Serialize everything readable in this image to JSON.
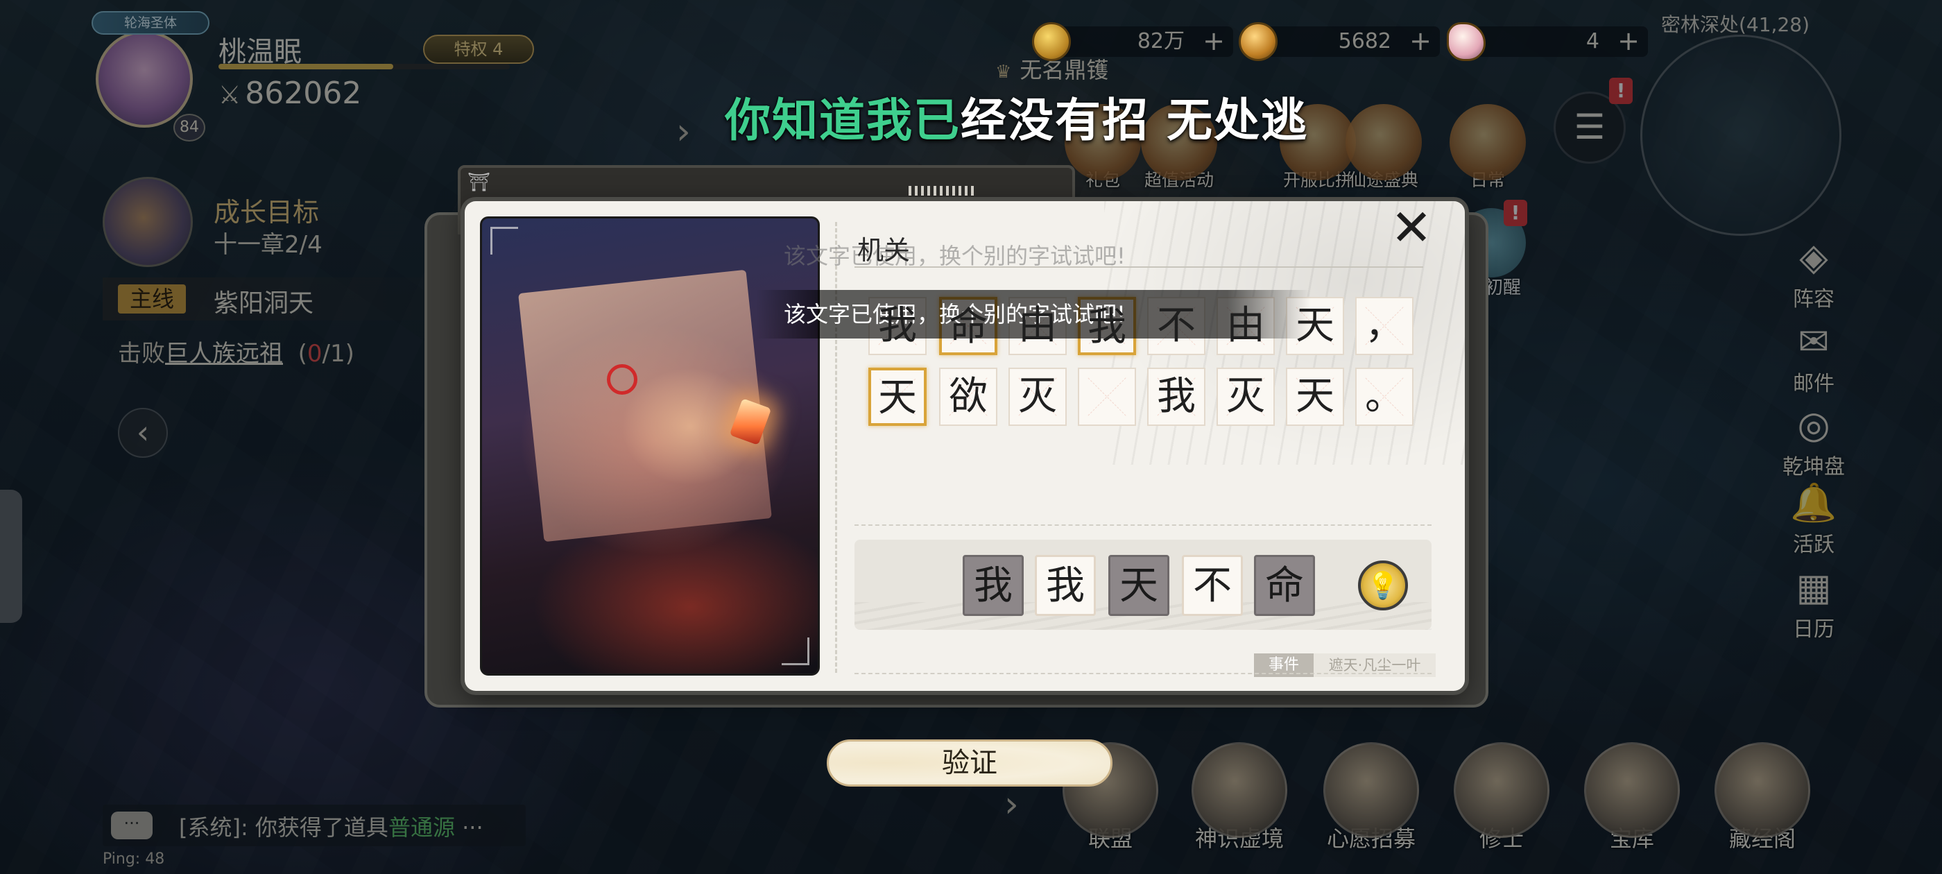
{
  "player": {
    "realm": "轮海圣体",
    "name": "桃温眠",
    "vip": "特权 4",
    "power": "862062",
    "level": "84"
  },
  "resources": [
    {
      "icon": "copper-coin-icon",
      "value": "82万"
    },
    {
      "icon": "gold-ingot-icon",
      "value": "5682"
    },
    {
      "icon": "feather-icon",
      "value": "4"
    }
  ],
  "plus_label": "+",
  "location": "密林深处(41,28)",
  "nameless": "无名鼎镬",
  "lyric": {
    "sung": "你知道我已",
    "rest": "经没有招 无处逃"
  },
  "top_activities": [
    {
      "label": "礼包"
    },
    {
      "label": "超值活动"
    },
    {
      "label": "开服比拼"
    },
    {
      "label": "仙途盛典"
    },
    {
      "label": "日常"
    }
  ],
  "menu_icon": "☰",
  "badge": "!",
  "goal": {
    "title": "成长目标",
    "progress": "十一章2/4"
  },
  "quest": {
    "tag": "主线",
    "name": "紫阳洞天",
    "desc_prefix": "击败",
    "target": "巨人族远祖",
    "count_open": "(",
    "count_done": "0",
    "count_total": "/1)"
  },
  "right_side": [
    {
      "icon": "formation-icon",
      "glyph": "◈",
      "label": "阵容"
    },
    {
      "icon": "mail-icon",
      "glyph": "✉",
      "label": "邮件"
    },
    {
      "icon": "compass-icon",
      "glyph": "◎",
      "label": "乾坤盘"
    },
    {
      "icon": "bell-icon",
      "glyph": "🔔",
      "label": "活跃"
    },
    {
      "icon": "calendar-icon",
      "glyph": "▦",
      "label": "日历"
    }
  ],
  "dream_label": "梦初醒",
  "modal": {
    "title": "机关",
    "ghost_hint": "该文字已使用，换个别的字试试吧!",
    "toast": "该文字已使用，换个别的字试试吧!",
    "close": "✕",
    "row1": [
      "我",
      "命",
      "由",
      "我",
      "不",
      "由",
      "天",
      "，"
    ],
    "row2": [
      "天",
      "欲",
      "灭",
      "",
      "我",
      "灭",
      "天",
      "。"
    ],
    "tiles": [
      {
        "char": "我",
        "used": true
      },
      {
        "char": "我",
        "used": false
      },
      {
        "char": "天",
        "used": true
      },
      {
        "char": "不",
        "used": false
      },
      {
        "char": "命",
        "used": true
      }
    ],
    "hint_icon": "💡",
    "tag_event": "事件",
    "tag_source": "遮天·凡尘一叶",
    "verify": "验证"
  },
  "chat": {
    "prefix": "[系统]: 你获得了道具",
    "item": "普通源",
    "more": "···",
    "bubble": "···"
  },
  "ping": "Ping: 48",
  "bottom": [
    {
      "icon": "alliance-icon",
      "label": "联盟"
    },
    {
      "icon": "spirit-realm-icon",
      "label": "神识虚境"
    },
    {
      "icon": "wish-icon",
      "label": "心愿招募"
    },
    {
      "icon": "cultivator-icon",
      "label": "修士"
    },
    {
      "icon": "treasury-icon",
      "label": "宝库"
    },
    {
      "icon": "sutra-pavilion-icon",
      "label": "藏经阁"
    }
  ]
}
